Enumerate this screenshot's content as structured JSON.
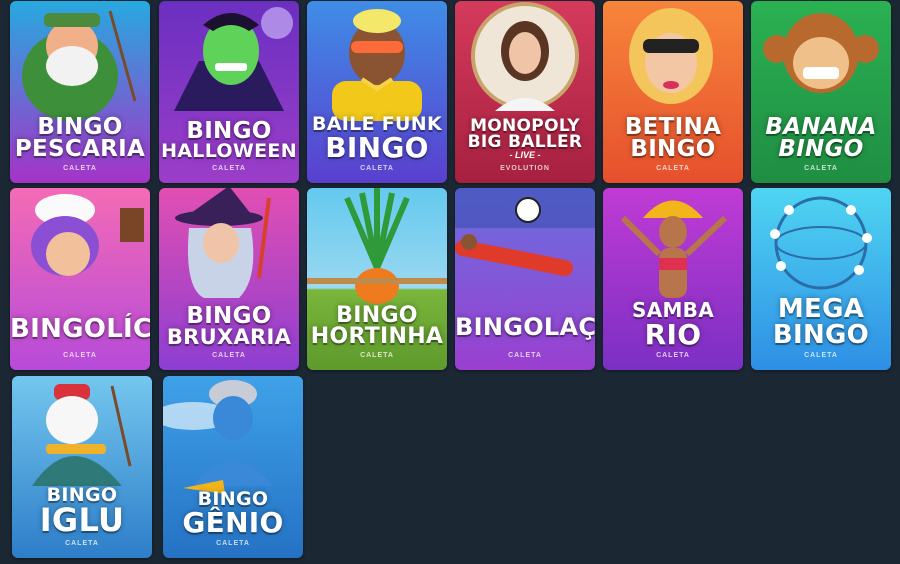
{
  "games": [
    {
      "line1": "Bingo",
      "line2": "Pescaria",
      "provider": "CALETA",
      "bg1": "#27a9df",
      "bg2": "#a533c8"
    },
    {
      "line1": "Bingo",
      "line2": "Halloween",
      "provider": "CALETA",
      "bg1": "#6b2fc0",
      "bg2": "#9b3ec9"
    },
    {
      "line1": "Baile Funk",
      "line2": "Bingo",
      "provider": "CALETA",
      "bg1": "#3f8de6",
      "bg2": "#5a3fcf"
    },
    {
      "line1": "Monopoly",
      "line2": "Big Baller",
      "live": "- LIVE -",
      "provider": "EVOLUTION",
      "bg1": "#d53a5b",
      "bg2": "#a62040"
    },
    {
      "line1": "Betina",
      "line2": "Bingo",
      "provider": "CALETA",
      "bg1": "#f7853a",
      "bg2": "#e6502d"
    },
    {
      "line1": "Banana",
      "line2": "Bingo",
      "provider": "CALETA",
      "bg1": "#2bb152",
      "bg2": "#1f8e43"
    },
    {
      "line1": "Bingolícia",
      "line2": "",
      "provider": "CALETA",
      "bg1": "#f46bb5",
      "bg2": "#b64ad9"
    },
    {
      "line1": "Bingo",
      "line2": "Bruxaria",
      "provider": "CALETA",
      "bg1": "#e14fb3",
      "bg2": "#8d3ed2"
    },
    {
      "line1": "Bingo",
      "line2": "Hortinha",
      "provider": "CALETA",
      "bg1": "#64c9ef",
      "bg2": "#7ab63b"
    },
    {
      "line1": "Bingolaço",
      "line2": "",
      "provider": "CALETA",
      "bg1": "#6a6fe0",
      "bg2": "#9a3fd0"
    },
    {
      "line1": "Samba",
      "line2": "Rio",
      "provider": "CALETA",
      "bg1": "#c03bd4",
      "bg2": "#7b2fc4"
    },
    {
      "line1": "Mega",
      "line2": "Bingo",
      "provider": "CALETA",
      "bg1": "#4fd5f2",
      "bg2": "#2e8fe5"
    },
    {
      "line1": "Bingo",
      "line2": "Iglu",
      "provider": "CALETA",
      "bg1": "#74c7ee",
      "bg2": "#2d7ec9"
    },
    {
      "line1": "Bingo",
      "line2": "Gênio",
      "provider": "CALETA",
      "bg1": "#3fa1e8",
      "bg2": "#2572c4"
    }
  ]
}
